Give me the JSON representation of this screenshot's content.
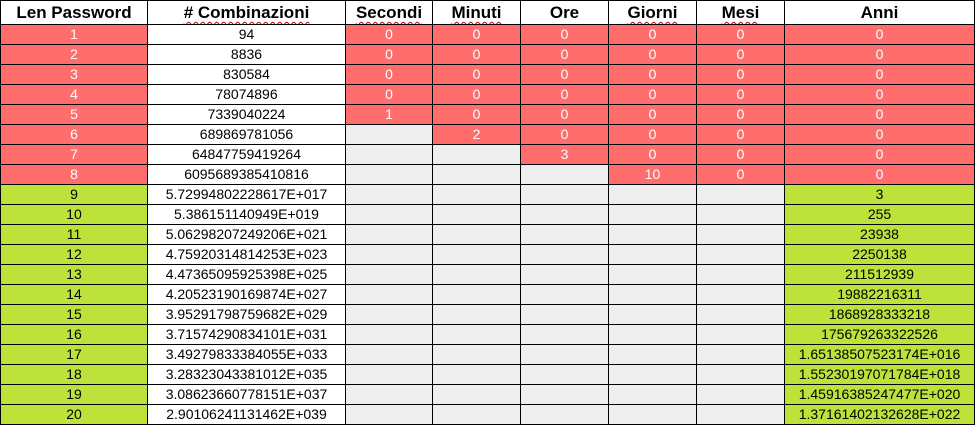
{
  "columns": [
    {
      "label": "Len Password",
      "spell": false
    },
    {
      "label": "# Combinazioni",
      "spell": true
    },
    {
      "label": "Secondi",
      "spell": true
    },
    {
      "label": "Minuti",
      "spell": true
    },
    {
      "label": "Ore",
      "spell": false
    },
    {
      "label": "Giorni",
      "spell": true
    },
    {
      "label": "Mesi",
      "spell": true
    },
    {
      "label": "Anni",
      "spell": false
    }
  ],
  "colors": {
    "red": "#ff6d6d",
    "green": "#bde33b",
    "gray": "#eeeeee"
  },
  "rows": [
    {
      "len": "1",
      "comb": "94",
      "sec": "0",
      "min": "0",
      "ore": "0",
      "gio": "0",
      "mes": "0",
      "ann": "0"
    },
    {
      "len": "2",
      "comb": "8836",
      "sec": "0",
      "min": "0",
      "ore": "0",
      "gio": "0",
      "mes": "0",
      "ann": "0"
    },
    {
      "len": "3",
      "comb": "830584",
      "sec": "0",
      "min": "0",
      "ore": "0",
      "gio": "0",
      "mes": "0",
      "ann": "0"
    },
    {
      "len": "4",
      "comb": "78074896",
      "sec": "0",
      "min": "0",
      "ore": "0",
      "gio": "0",
      "mes": "0",
      "ann": "0"
    },
    {
      "len": "5",
      "comb": "7339040224",
      "sec": "1",
      "min": "0",
      "ore": "0",
      "gio": "0",
      "mes": "0",
      "ann": "0"
    },
    {
      "len": "6",
      "comb": "689869781056",
      "sec": "",
      "min": "2",
      "ore": "0",
      "gio": "0",
      "mes": "0",
      "ann": "0"
    },
    {
      "len": "7",
      "comb": "64847759419264",
      "sec": "",
      "min": "",
      "ore": "3",
      "gio": "0",
      "mes": "0",
      "ann": "0"
    },
    {
      "len": "8",
      "comb": "6095689385410816",
      "sec": "",
      "min": "",
      "ore": "",
      "gio": "10",
      "mes": "0",
      "ann": "0"
    },
    {
      "len": "9",
      "comb": "5.72994802228617E+017",
      "sec": "",
      "min": "",
      "ore": "",
      "gio": "",
      "mes": "",
      "ann": "3"
    },
    {
      "len": "10",
      "comb": "5.386151140949E+019",
      "sec": "",
      "min": "",
      "ore": "",
      "gio": "",
      "mes": "",
      "ann": "255"
    },
    {
      "len": "11",
      "comb": "5.06298207249206E+021",
      "sec": "",
      "min": "",
      "ore": "",
      "gio": "",
      "mes": "",
      "ann": "23938"
    },
    {
      "len": "12",
      "comb": "4.75920314814253E+023",
      "sec": "",
      "min": "",
      "ore": "",
      "gio": "",
      "mes": "",
      "ann": "2250138"
    },
    {
      "len": "13",
      "comb": "4.47365095925398E+025",
      "sec": "",
      "min": "",
      "ore": "",
      "gio": "",
      "mes": "",
      "ann": "211512939"
    },
    {
      "len": "14",
      "comb": "4.20523190169874E+027",
      "sec": "",
      "min": "",
      "ore": "",
      "gio": "",
      "mes": "",
      "ann": "19882216311"
    },
    {
      "len": "15",
      "comb": "3.95291798759682E+029",
      "sec": "",
      "min": "",
      "ore": "",
      "gio": "",
      "mes": "",
      "ann": "1868928333218"
    },
    {
      "len": "16",
      "comb": "3.71574290834101E+031",
      "sec": "",
      "min": "",
      "ore": "",
      "gio": "",
      "mes": "",
      "ann": "175679263322526"
    },
    {
      "len": "17",
      "comb": "3.49279833384055E+033",
      "sec": "",
      "min": "",
      "ore": "",
      "gio": "",
      "mes": "",
      "ann": "1.65138507523174E+016"
    },
    {
      "len": "18",
      "comb": "3.28323043381012E+035",
      "sec": "",
      "min": "",
      "ore": "",
      "gio": "",
      "mes": "",
      "ann": "1.55230197071784E+018"
    },
    {
      "len": "19",
      "comb": "3.08623660778151E+037",
      "sec": "",
      "min": "",
      "ore": "",
      "gio": "",
      "mes": "",
      "ann": "1.45916385247477E+020"
    },
    {
      "len": "20",
      "comb": "2.90106241131462E+039",
      "sec": "",
      "min": "",
      "ore": "",
      "gio": "",
      "mes": "",
      "ann": "1.37161402132628E+022"
    }
  ]
}
